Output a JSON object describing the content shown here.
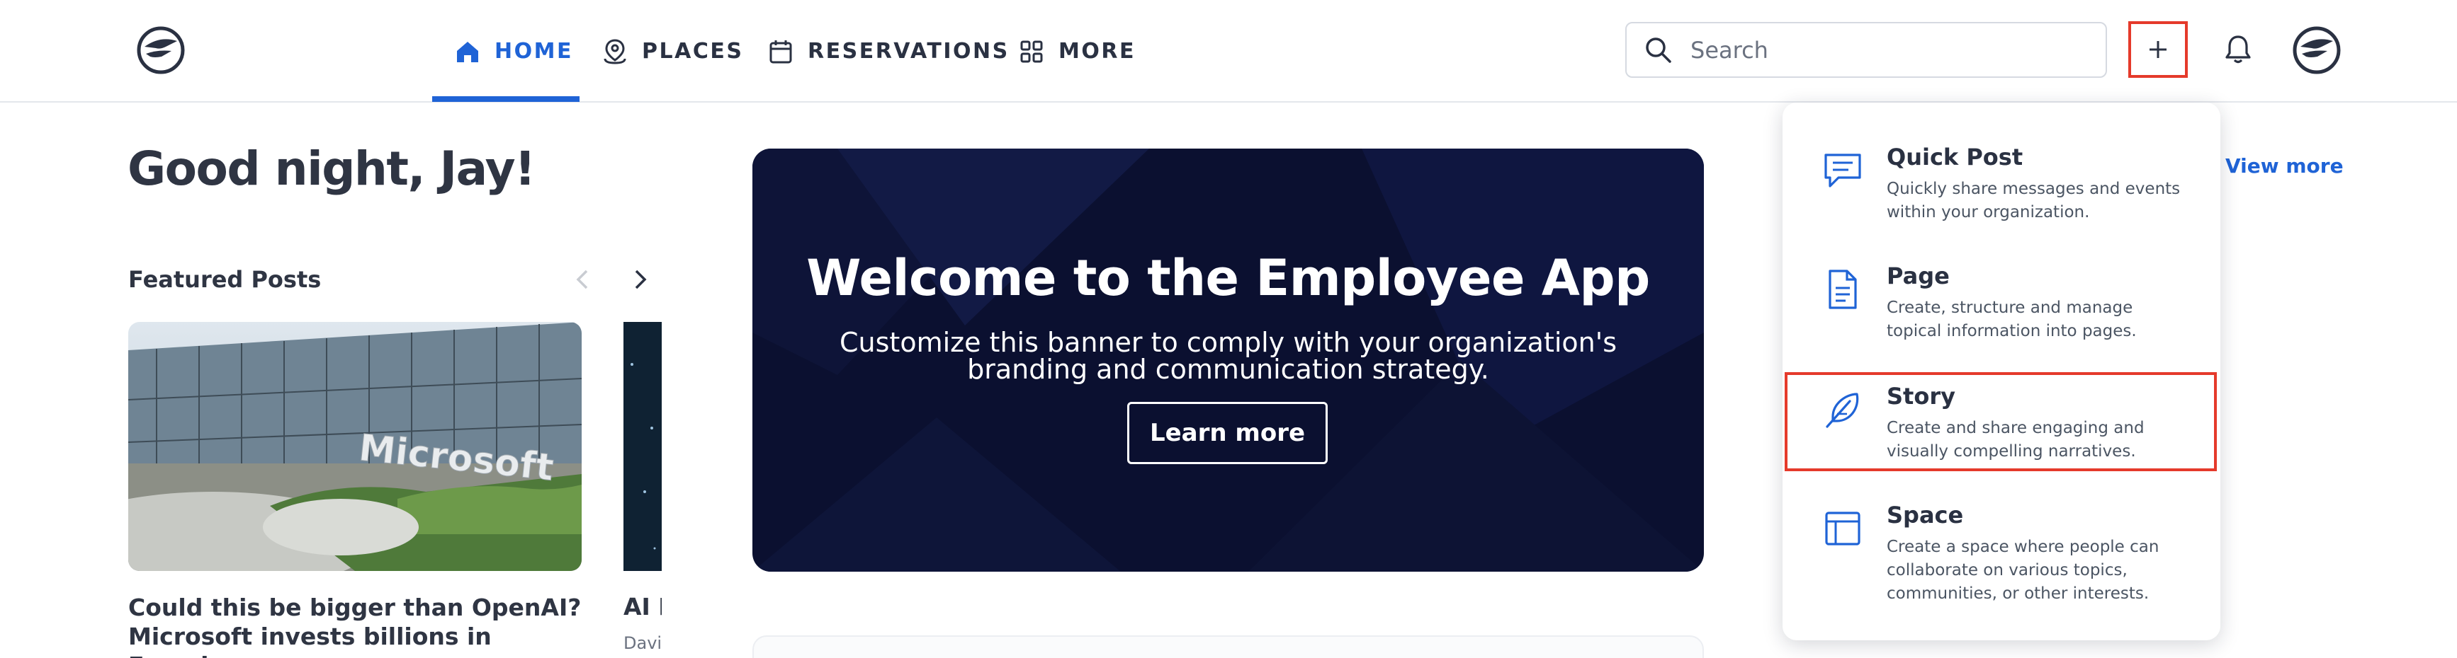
{
  "nav": {
    "items": [
      {
        "label": "HOME",
        "icon": "home-icon",
        "active": true
      },
      {
        "label": "PLACES",
        "icon": "places-icon"
      },
      {
        "label": "RESERVATIONS",
        "icon": "calendar-icon"
      },
      {
        "label": "MORE",
        "icon": "grid-icon"
      }
    ]
  },
  "search": {
    "placeholder": "Search"
  },
  "greeting": "Good night, Jay!",
  "featured": {
    "title": "Featured Posts",
    "posts": [
      {
        "title": "Could this be bigger than OpenAI? Microsoft invests billions in French...",
        "image_text": "Microsoft"
      },
      {
        "title": "AI F",
        "author": "Davi"
      }
    ]
  },
  "banner": {
    "title": "Welcome to the Employee App",
    "subtitle": "Customize this banner to comply with your organization's branding and communication strategy.",
    "button": "Learn more"
  },
  "view_more": "View more",
  "create_menu": {
    "items": [
      {
        "label": "Quick Post",
        "description": "Quickly share messages and events within your organization.",
        "icon": "chat-icon"
      },
      {
        "label": "Page",
        "description": "Create, structure and manage topical information into pages.",
        "icon": "document-icon"
      },
      {
        "label": "Story",
        "description": "Create and share engaging and visually compelling narratives.",
        "icon": "feather-icon",
        "highlighted": true
      },
      {
        "label": "Space",
        "description": "Create a space where people can collaborate on various topics, communities, or other interests.",
        "icon": "layout-icon"
      }
    ]
  },
  "colors": {
    "accent": "#1f63d6",
    "highlight": "#e53a2b",
    "banner_bg": "#0b1030",
    "text": "#2a3142"
  }
}
